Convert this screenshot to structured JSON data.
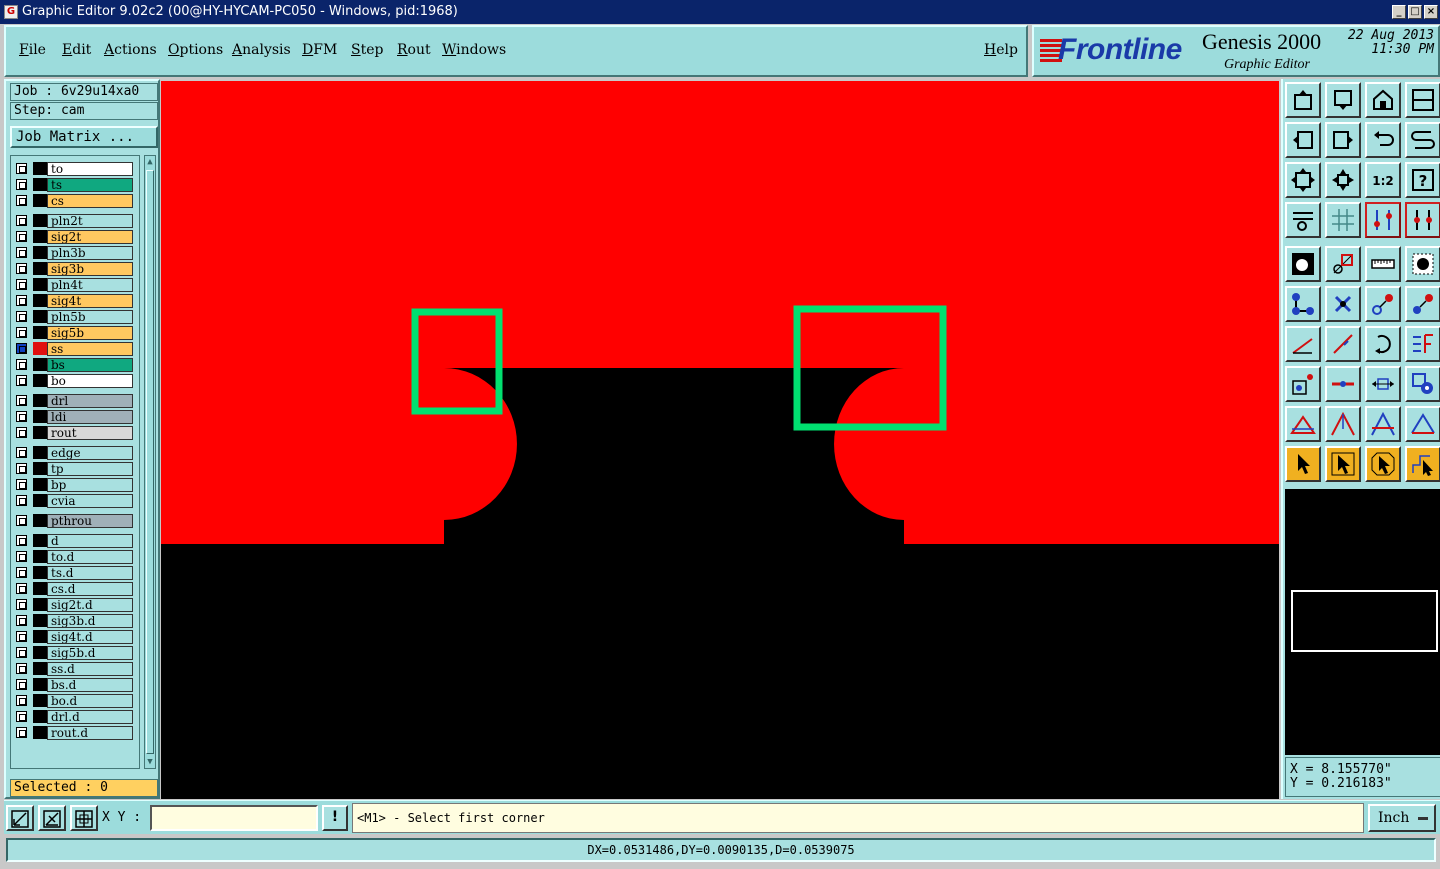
{
  "window": {
    "title": "Graphic Editor 9.02c2 (00@HY-HYCAM-PC050 - Windows, pid:1968)",
    "min_label": "_",
    "max_label": "□",
    "close_label": "×"
  },
  "menu": {
    "items": [
      "File",
      "Edit",
      "Actions",
      "Options",
      "Analysis",
      "DFM",
      "Step",
      "Rout",
      "Windows"
    ],
    "help": "Help"
  },
  "logo": {
    "brand": "Frontline",
    "product": "Genesis 2000",
    "subtitle": "Graphic Editor",
    "date": "22 Aug 2013",
    "time": "11:30 PM"
  },
  "job": {
    "job_label": "Job : 6v29u14xa0",
    "step_label": "Step: cam",
    "matrix_button": "Job Matrix ..."
  },
  "layers": [
    {
      "name": "to",
      "color": "#ffffff"
    },
    {
      "name": "ts",
      "color": "#10a880"
    },
    {
      "name": "cs",
      "color": "#ffc860"
    },
    {
      "name": "pln2t",
      "color": "#a8e0e0"
    },
    {
      "name": "sig2t",
      "color": "#ffc860"
    },
    {
      "name": "pln3b",
      "color": "#a8e0e0"
    },
    {
      "name": "sig3b",
      "color": "#ffc860"
    },
    {
      "name": "pln4t",
      "color": "#a8e0e0"
    },
    {
      "name": "sig4t",
      "color": "#ffc860"
    },
    {
      "name": "pln5b",
      "color": "#a8e0e0"
    },
    {
      "name": "sig5b",
      "color": "#ffc860"
    },
    {
      "name": "ss",
      "color": "#ffc860",
      "active": true
    },
    {
      "name": "bs",
      "color": "#10a880"
    },
    {
      "name": "bo",
      "color": "#ffffff"
    },
    {
      "name": "drl",
      "color": "#a0b0b8"
    },
    {
      "name": "ldi",
      "color": "#a0b0b8"
    },
    {
      "name": "rout",
      "color": "#d8d8d8"
    },
    {
      "name": "edge",
      "color": "#a8e0e0"
    },
    {
      "name": "tp",
      "color": "#a8e0e0"
    },
    {
      "name": "bp",
      "color": "#a8e0e0"
    },
    {
      "name": "cvia",
      "color": "#a8e0e0"
    },
    {
      "name": "pthrou",
      "color": "#a0b0b8"
    },
    {
      "name": "d",
      "color": "#a8e0e0"
    },
    {
      "name": "to.d",
      "color": "#a8e0e0"
    },
    {
      "name": "ts.d",
      "color": "#a8e0e0"
    },
    {
      "name": "cs.d",
      "color": "#a8e0e0"
    },
    {
      "name": "sig2t.d",
      "color": "#a8e0e0"
    },
    {
      "name": "sig3b.d",
      "color": "#a8e0e0"
    },
    {
      "name": "sig4t.d",
      "color": "#a8e0e0"
    },
    {
      "name": "sig5b.d",
      "color": "#a8e0e0"
    },
    {
      "name": "ss.d",
      "color": "#a8e0e0"
    },
    {
      "name": "bs.d",
      "color": "#a8e0e0"
    },
    {
      "name": "bo.d",
      "color": "#a8e0e0"
    },
    {
      "name": "drl.d",
      "color": "#a8e0e0"
    },
    {
      "name": "rout.d",
      "color": "#a8e0e0"
    }
  ],
  "selected": "Selected : 0",
  "toolbar": {
    "scale_label": "1:2",
    "help_label": "?"
  },
  "coords": {
    "x": "X = 8.155770\"",
    "y": "Y = 0.216183\""
  },
  "command": {
    "xy_label": "X Y :",
    "xy_value": "",
    "excl_label": "!",
    "message": "<M1> - Select first corner",
    "unit": "Inch"
  },
  "status": "DX=0.0531486,DY=0.0090135,D=0.0539075",
  "colors": {
    "copper": "#ff0000",
    "highlight": "#00e070",
    "panel": "#a8e0e0",
    "background": "#000000"
  }
}
